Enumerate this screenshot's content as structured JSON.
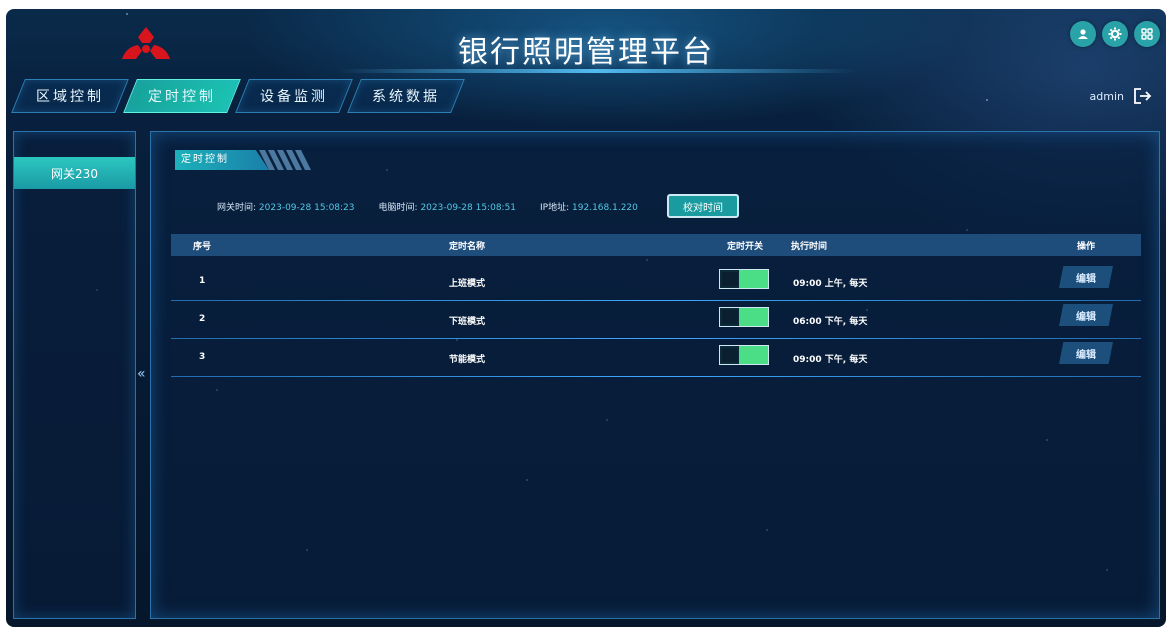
{
  "header": {
    "title": "银行照明管理平台",
    "username": "admin",
    "icons": [
      "user-icon",
      "gear-icon",
      "apps-grid-icon",
      "logout-icon"
    ]
  },
  "nav": {
    "items": [
      {
        "label": "区域控制",
        "active": false
      },
      {
        "label": "定时控制",
        "active": true
      },
      {
        "label": "设备监测",
        "active": false
      },
      {
        "label": "系统数据",
        "active": false
      }
    ]
  },
  "sidebar": {
    "gateway": "网关230",
    "collapse_glyph": "«"
  },
  "main": {
    "section_title": "定时控制",
    "info": {
      "gateway_time_label": "网关时间:",
      "gateway_time": "2023-09-28 15:08:23",
      "pc_time_label": "电脑时间:",
      "pc_time": "2023-09-28 15:08:51",
      "ip_label": "IP地址:",
      "ip": "192.168.1.220"
    },
    "sync_button": "校对时间",
    "table": {
      "headers": {
        "index": "序号",
        "name": "定时名称",
        "switch": "定时开关",
        "time": "执行时间",
        "action": "操作"
      },
      "rows": [
        {
          "index": "1",
          "name": "上班模式",
          "time": "09:00 上午, 每天",
          "switch_on": true,
          "action": "编辑"
        },
        {
          "index": "2",
          "name": "下班模式",
          "time": "06:00 下午, 每天",
          "switch_on": true,
          "action": "编辑"
        },
        {
          "index": "3",
          "name": "节能模式",
          "time": "09:00 下午, 每天",
          "switch_on": true,
          "action": "编辑"
        }
      ]
    }
  },
  "colors": {
    "accent_teal": "#1cc3b2",
    "switch_green": "#4cde86",
    "info_value": "#52c8e6",
    "logo_red": "#d8141c"
  }
}
